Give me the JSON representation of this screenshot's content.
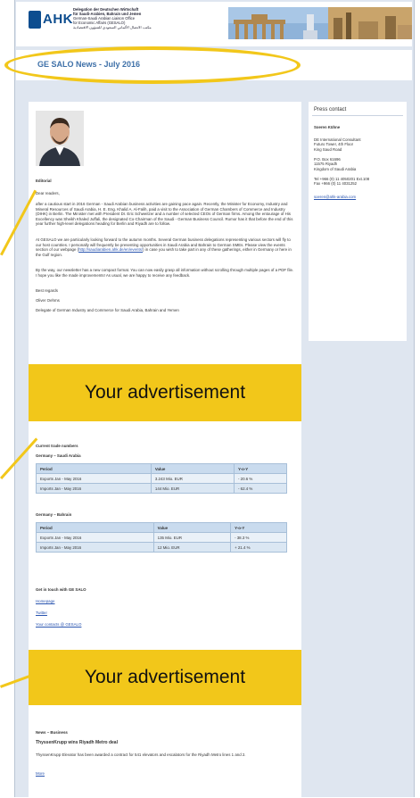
{
  "header": {
    "logo_text": "AHK",
    "chamber_lines": [
      "Delegation der Deutschen Wirtschaft",
      "für Saudi-Arabien, Bahrain und Jemen",
      "German-Saudi Arabian Liaison Office",
      "for Economic Affairs (GESALO)",
      "مكتب الاتصال الألماني السعودي للشؤون الاقتصادية"
    ]
  },
  "newsletter_title": "GE SALO News - July 2016",
  "sidebar": {
    "title": "Press contact",
    "name": "Soeren Kühne",
    "org_lines": [
      "DE International Consultant",
      "Futuro Tower, 4th Floor",
      "King Saud Road"
    ],
    "address_lines": [
      "P.O. Box 61696",
      "11575 Riyadh",
      "Kingdom of Saudi Arabia"
    ],
    "phone_lines": [
      "Tel +966 (0) 11 4050201 Ext.108",
      "Fax +966 (0) 11 4031252"
    ],
    "email": "soeren@ahk-arabia.com"
  },
  "editorial": {
    "heading": "Editorial",
    "salutation": "Dear readers,",
    "para1": "after a cautious start in 2016 German - Saudi Arabian business activities are gaining pace again. Recently, the Minister for Economy, Industry and Mineral Resources of Saudi Arabia, H. E. Eng. Khalid A. Al-Falih, paid a visit to the Association of German Chambers of Commerce and Industry (DIHK) in Berlin. The Minister met with President Dr. Eric Schweitzer and a number of selected CEOs of German firms. Among the entourage of His Excellency was Sheikh Khaled Juffali, the designated Co-Chairman of the Saudi - German Business Council. Rumor has it that before the end of this year further high-level delegations heading for Berlin and Riyadh are to follow.",
    "para2_a": "At GESALO we are particularly looking forward to the autumn months. Several German business delegations representing various sectors will fly to our host countries. I personally will frequently be presenting opportunities in Saudi Arabia and Bahrain to German SMEs. Please view the events section of our webpage (",
    "para2_link": "http://saudiarabien.ahk.de/en/events/",
    "para2_b": ") in case you wish to take part in any of these gatherings, either in Germany or here in the Gulf region.",
    "para3": "By the way, our newsletter has a new compact format. You can now easily grasp all information without scrolling through multiple pages of a PDF file. I hope you like the made improvements! As usual, we are happy to receive any feedback.",
    "regards": "Best regards",
    "signature": "Oliver Oehms",
    "position": "Delegate of German Industry and Commerce for Saudi Arabia, Bahrain and Yemen"
  },
  "ad_text": "Your advertisement",
  "trade": {
    "heading": "Current trade numbers",
    "tables": [
      {
        "title": "Germany – Saudi Arabia",
        "headers": [
          "Period",
          "Value",
          "Y-o-Y"
        ],
        "rows": [
          [
            "Exports Jan - May 2016",
            "3.243 Mio. EUR",
            "- 20.6 %"
          ],
          [
            "Imports Jan - May 2016",
            "144 Mio. EUR",
            "- 62.4 %"
          ]
        ]
      },
      {
        "title": "Germany – Bahrain",
        "headers": [
          "Period",
          "Value",
          "Y-o-Y"
        ],
        "rows": [
          [
            "Exports Jan - May 2016",
            "135 Mio. EUR",
            "- 38.3 %"
          ],
          [
            "Imports Jan - May 2016",
            "12 Mio. EUR",
            "+ 21.4 %"
          ]
        ]
      }
    ]
  },
  "contact": {
    "heading": "Get in touch with GE SALO",
    "links": [
      "Homepage",
      "Twitter",
      "Your contacts @ GESALO"
    ]
  },
  "news": {
    "heading": "News – Business",
    "item_title": "ThyssenKrupp wins Riyadh Metro deal",
    "item_text": "ThyssenKrupp Elevator has been awarded a contract for 541 elevators and escalators for the Riyadh Metro lines 1 and 2.",
    "more": "More"
  },
  "colors": {
    "accent_yellow": "#f2c71a",
    "title_blue": "#3e70a8",
    "link_blue": "#2a55b0",
    "frame": "#dfe6f0"
  }
}
